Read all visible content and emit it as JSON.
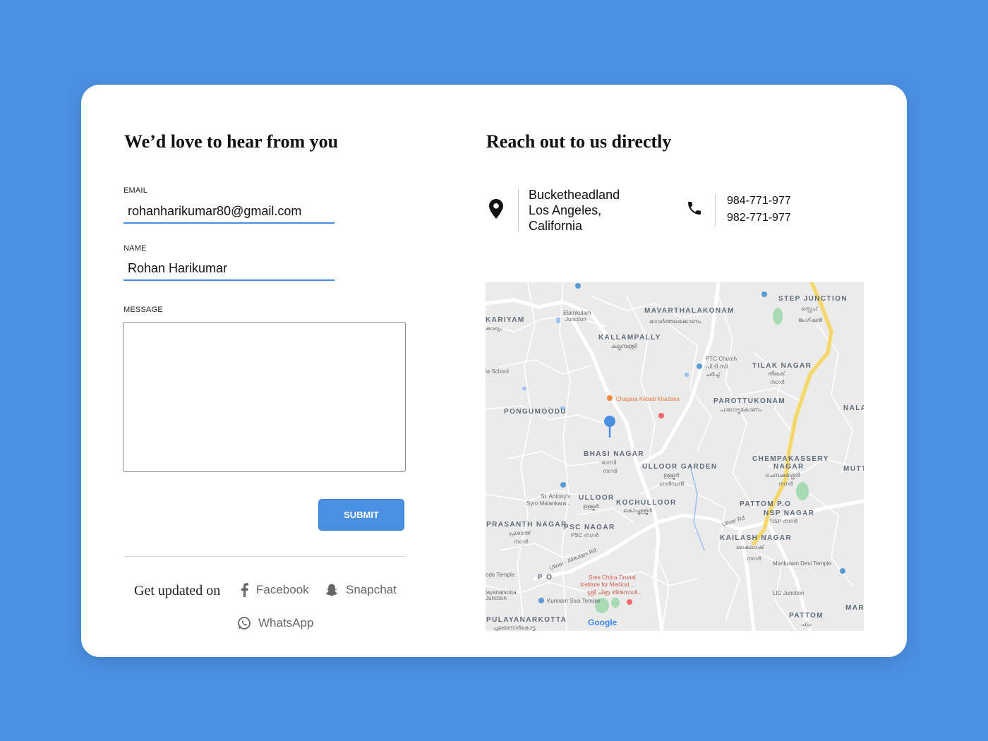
{
  "form": {
    "title": "We’d love to hear from you",
    "email_label": "EMAIL",
    "email_value": "rohanharikumar80@gmail.com",
    "name_label": "NAME",
    "name_value": "Rohan Harikumar",
    "message_label": "MESSAGE",
    "message_value": "",
    "submit_label": "SUBMIT"
  },
  "social": {
    "title": "Get updated on",
    "links": [
      "Facebook",
      "Snapchat",
      "WhatsApp"
    ]
  },
  "contact": {
    "title": "Reach out to us directly",
    "address": [
      "Bucketheadland",
      "Los Angeles,",
      "California"
    ],
    "phones": [
      "984-771-977",
      "982-771-977"
    ]
  },
  "map": {
    "labels": {
      "mavarthalakonam": "MAVARTHALAKONAM",
      "mavarthalakonam_ml": "മാവർത്തലക്കോണം",
      "kallampally": "KALLAMPALLY",
      "kallampally_ml": "കല്ലമ്പള്ളി",
      "stepjunction": "STEP JUNCTION",
      "stepjunction_ml1": "സ്റ്റെപ്",
      "stepjunction_ml2": "ജംഗ്ഷൻ",
      "kariyam": "KARIYAM",
      "kariyam_ml": "കാര്യം",
      "elamkulam": "Elamkulam",
      "elamkulam2": "Junction",
      "ptcchurch": "PTC Church",
      "ptcchurch_ml1": "പി.ടി.സി",
      "ptcchurch_ml2": "ചർച്ച്",
      "tilaknagar": "TILAK NAGAR",
      "tilaknagar_ml1": "തിലക്",
      "tilaknagar_ml2": "നഗർ",
      "laschool": "la School",
      "chagara": "Chagara Kebab Khazana",
      "parottukonam": "PAROTTUKONAM",
      "parottukonam_ml": "പാറോട്ടുകോണം",
      "pongumoodu": "PONGUMOODU",
      "nala": "NALA",
      "bhasinagar": "BHASI NAGAR",
      "bhasinagar_ml1": "ഭാസി",
      "bhasinagar_ml2": "നഗർ",
      "ulloorgarden": "ULLOOR GARDEN",
      "ulloorgarden_ml1": "ഉള്ളൂർ",
      "ulloorgarden_ml2": "ഗാർഡൻ",
      "chempakassery": "CHEMPAKASSERY",
      "chempakassery2": "NAGAR",
      "chempakassery_ml1": "ചെമ്പകശ്ശേരി",
      "chempakassery_ml2": "നഗർ",
      "mutt": "MUTT",
      "stantony": "St. Antony's",
      "stantony2": "Syro Malankara...",
      "ulloor": "ULLOOR",
      "ulloor_ml": "ഉള്ളൂർ",
      "kochulloor": "KOCHULLOOR",
      "kochulloor_ml": "കൊച്ചുള്ളൂർ",
      "pattompo": "PATTOM P.O",
      "nspnagar": "NSP NAGAR",
      "nspnagar_ml": "NSP നഗർ",
      "prasanthnagar": "PRASANTH NAGAR",
      "prasanthnagar_ml1": "പ്രശാന്ത്",
      "prasanthnagar_ml2": "നഗർ",
      "pscnagar": "PSC NAGAR",
      "pscnagar_ml": "PSC നഗർ",
      "kailashnagar": "KAILASH NAGAR",
      "kailashnagar_ml1": "കൈലാഷ്",
      "kailashnagar_ml2": "നഗർ",
      "odetemple": "ode Temple",
      "po": "P O",
      "sreechitra1": "Sree Chitra Tirunal",
      "sreechitra2": "Institute for Medical...",
      "sreechitra3": "ശ്രീ ചിത്ര തിരുനാൾ...",
      "mankulam": "Mankulam Devi Temple",
      "licjunction": "LIC Junction",
      "kunnam": "Kunnam Siva Temple",
      "layanarkotta": "layanarkotta",
      "layanarkotta2": "Junction",
      "pulayanarkotta": "PULAYANARKOTTA",
      "pulayanarkotta_ml": "പുലയനാർകോട്ട",
      "pattom": "PATTOM",
      "pattom_ml": "പട്ടം",
      "mar": "MAR",
      "ulloorrd": "Ulloor Rd",
      "ulloorakkulamrd": "Ulloor - Akkulam Rd",
      "google": "Google"
    }
  }
}
